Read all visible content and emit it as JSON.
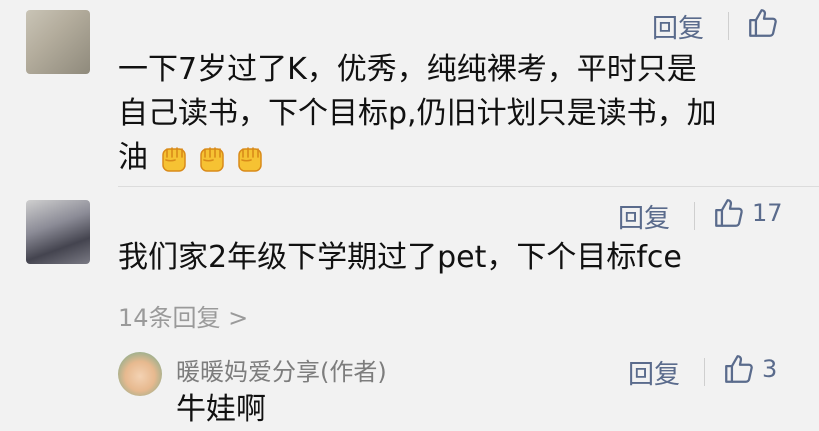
{
  "comments": [
    {
      "user_name": "",
      "reply_label": "回复",
      "like_count": "",
      "text_line1": "一下7岁过了K，优秀，纯纯裸考，平时只是",
      "text_line2": "自己读书，下个目标p,仍旧计划只是读书，加",
      "text_line3": "油"
    },
    {
      "user_name": "",
      "reply_label": "回复",
      "like_count": "17",
      "text_line1": "我们家2年级下学期过了pet，下个目标fce",
      "replies_link": "14条回复 >"
    }
  ],
  "reply": {
    "user_name": "暖暖妈爱分享(作者)",
    "reply_label": "回复",
    "like_count": "3",
    "text": "牛娃啊"
  },
  "icons": {
    "like": "thumbs-up-icon",
    "emoji": "raised-fist-emoji"
  }
}
